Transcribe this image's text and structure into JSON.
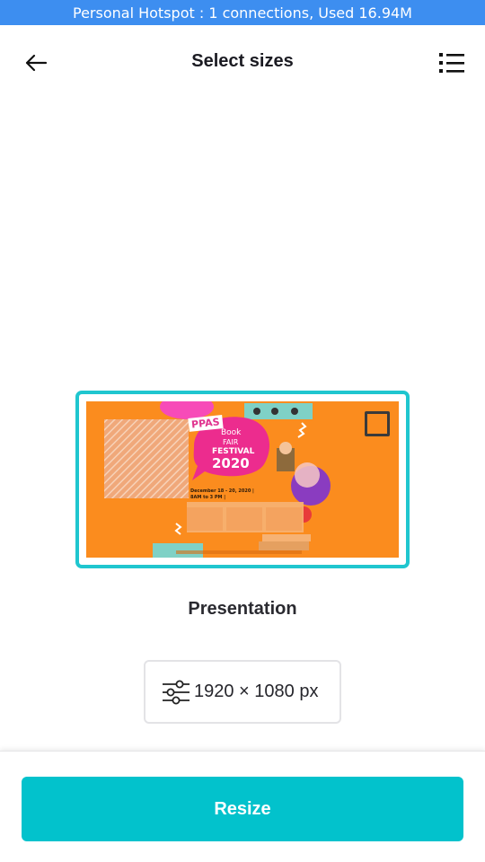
{
  "status_bar": {
    "text": "Personal Hotspot : 1 connections, Used 16.94M",
    "color": "#3d8ef0"
  },
  "header": {
    "back_icon": "arrow-left-icon",
    "title": "Select sizes",
    "list_icon": "list-icon"
  },
  "preview": {
    "border_color": "#1fc6cf",
    "background_color": "#fb8c1e",
    "thumbnail": {
      "badge": "PPAS",
      "title_lines": [
        "Book",
        "FAIR",
        "FESTIVAL"
      ],
      "year": "2020",
      "date_line_1": "December 18 - 20, 2020 |",
      "date_line_2": "8AM to 3 PM |"
    },
    "selected": false
  },
  "size": {
    "name": "Presentation",
    "icon": "sliders-icon",
    "dimensions": "1920 × 1080 px"
  },
  "actions": {
    "resize_label": "Resize",
    "resize_color": "#02c2cc"
  }
}
